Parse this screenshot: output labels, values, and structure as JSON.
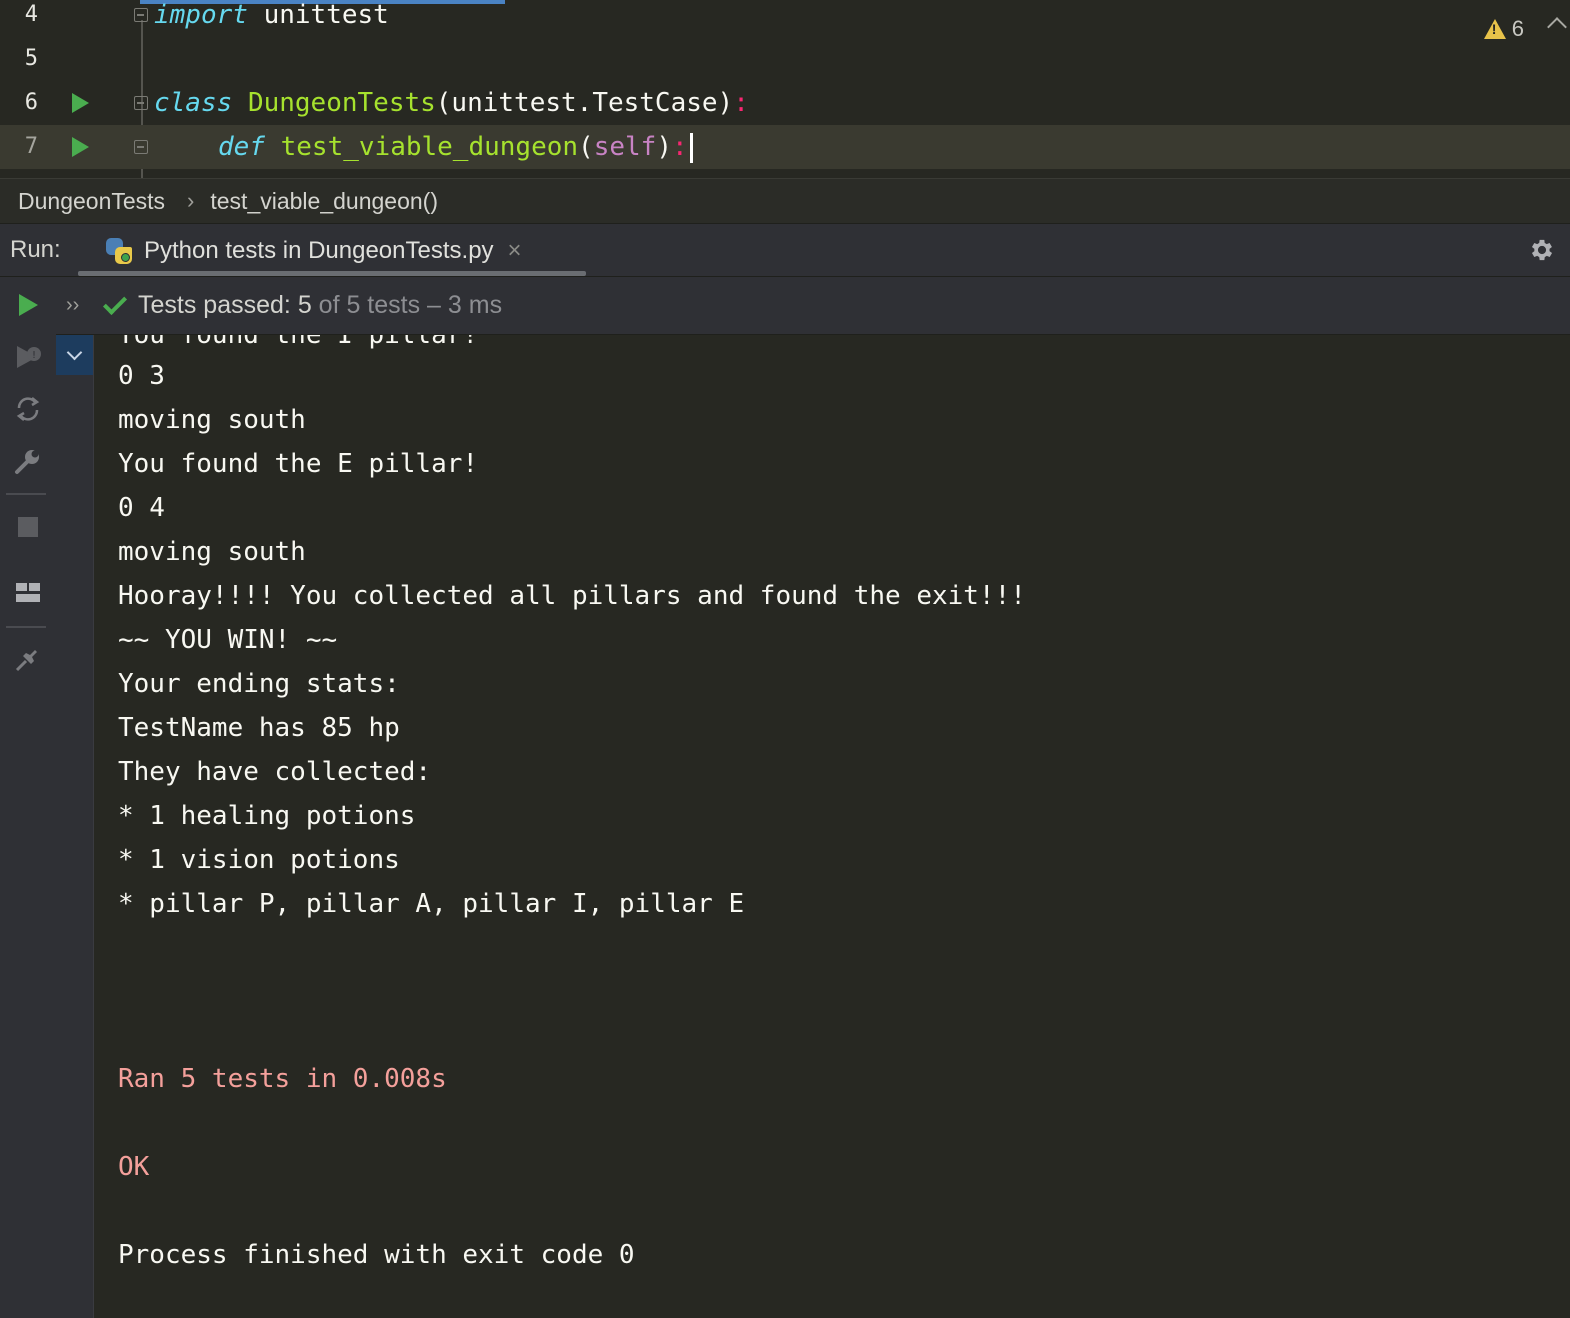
{
  "editor": {
    "lines": [
      {
        "number": "4",
        "kw": "import",
        "rest": " unittest"
      },
      {
        "number": "5"
      },
      {
        "number": "6",
        "kw": "class",
        "class_name": "DungeonTests",
        "args": "(unittest.TestCase)",
        "colon": ":"
      },
      {
        "number": "7",
        "kw": "def",
        "func_name": "test_viable_dungeon",
        "open": "(",
        "self": "self",
        "close": ")",
        "colon": ":"
      }
    ],
    "warnings_count": "6"
  },
  "breadcrumb": {
    "items": [
      "DungeonTests",
      "test_viable_dungeon()"
    ],
    "separator": "›"
  },
  "run_panel": {
    "label": "Run:",
    "tab_title": "Python tests in DungeonTests.py",
    "tab_close": "×",
    "status_prefix": "Tests passed: ",
    "status_passed": "5",
    "status_rest": " of 5 tests – 3 ms",
    "expand": "››"
  },
  "console": {
    "partial_top": "You found the I pillar!",
    "lines": [
      "0 3",
      "moving south",
      "You found the E pillar!",
      "0 4",
      "moving south",
      "Hooray!!!! You collected all pillars and found the exit!!!",
      "~~ YOU WIN! ~~",
      "Your ending stats:",
      "TestName has 85 hp",
      "They have collected:",
      "* 1 healing potions",
      "* 1 vision potions",
      "* pillar P, pillar A, pillar I, pillar E"
    ],
    "summary": "Ran 5 tests in 0.008s",
    "ok": "OK",
    "exit": "Process finished with exit code 0"
  },
  "colors": {
    "background": "#272822",
    "keyword": "#66d9ef",
    "class_name": "#a6e22e",
    "run_green": "#4aad4f",
    "stderr": "#f4a09b",
    "warning": "#e8c34a"
  },
  "icons": [
    "run-gutter-icon",
    "fold-icon",
    "warning-icon",
    "chevron-up-icon",
    "python-icon",
    "close-icon",
    "gear-icon",
    "rerun-icon",
    "rerun-failed-icon",
    "toggle-auto-test-icon",
    "settings-wrench-icon",
    "stop-icon",
    "layout-icon",
    "pin-icon",
    "check-icon",
    "chevron-down-icon"
  ]
}
